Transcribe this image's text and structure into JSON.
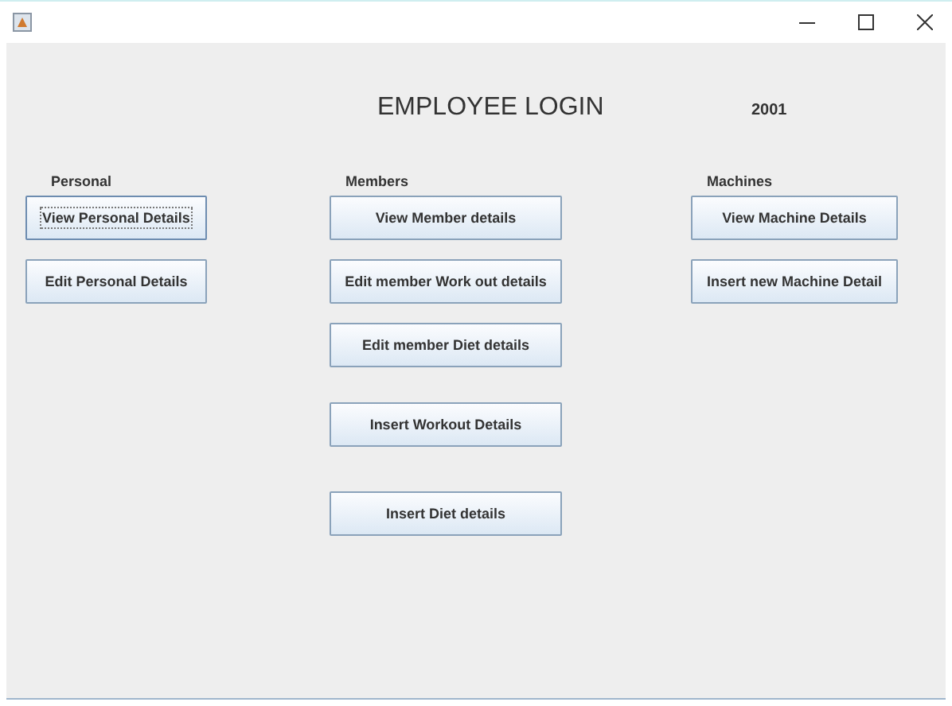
{
  "heading": "EMPLOYEE LOGIN",
  "id_label": "2001",
  "sections": [
    {
      "label": "Personal",
      "buttons": [
        {
          "label": "View Personal Details",
          "focused": true
        },
        {
          "label": "Edit Personal Details",
          "focused": false
        }
      ]
    },
    {
      "label": "Members",
      "buttons": [
        {
          "label": "View Member details",
          "focused": false
        },
        {
          "label": "Edit member Work out details",
          "focused": false
        },
        {
          "label": "Edit member Diet details",
          "focused": false
        },
        {
          "label": "Insert Workout Details",
          "focused": false
        },
        {
          "label": "Insert Diet details",
          "focused": false
        }
      ]
    },
    {
      "label": "Machines",
      "buttons": [
        {
          "label": "View Machine Details",
          "focused": false
        },
        {
          "label": "Insert new Machine Detail",
          "focused": false
        }
      ]
    }
  ]
}
